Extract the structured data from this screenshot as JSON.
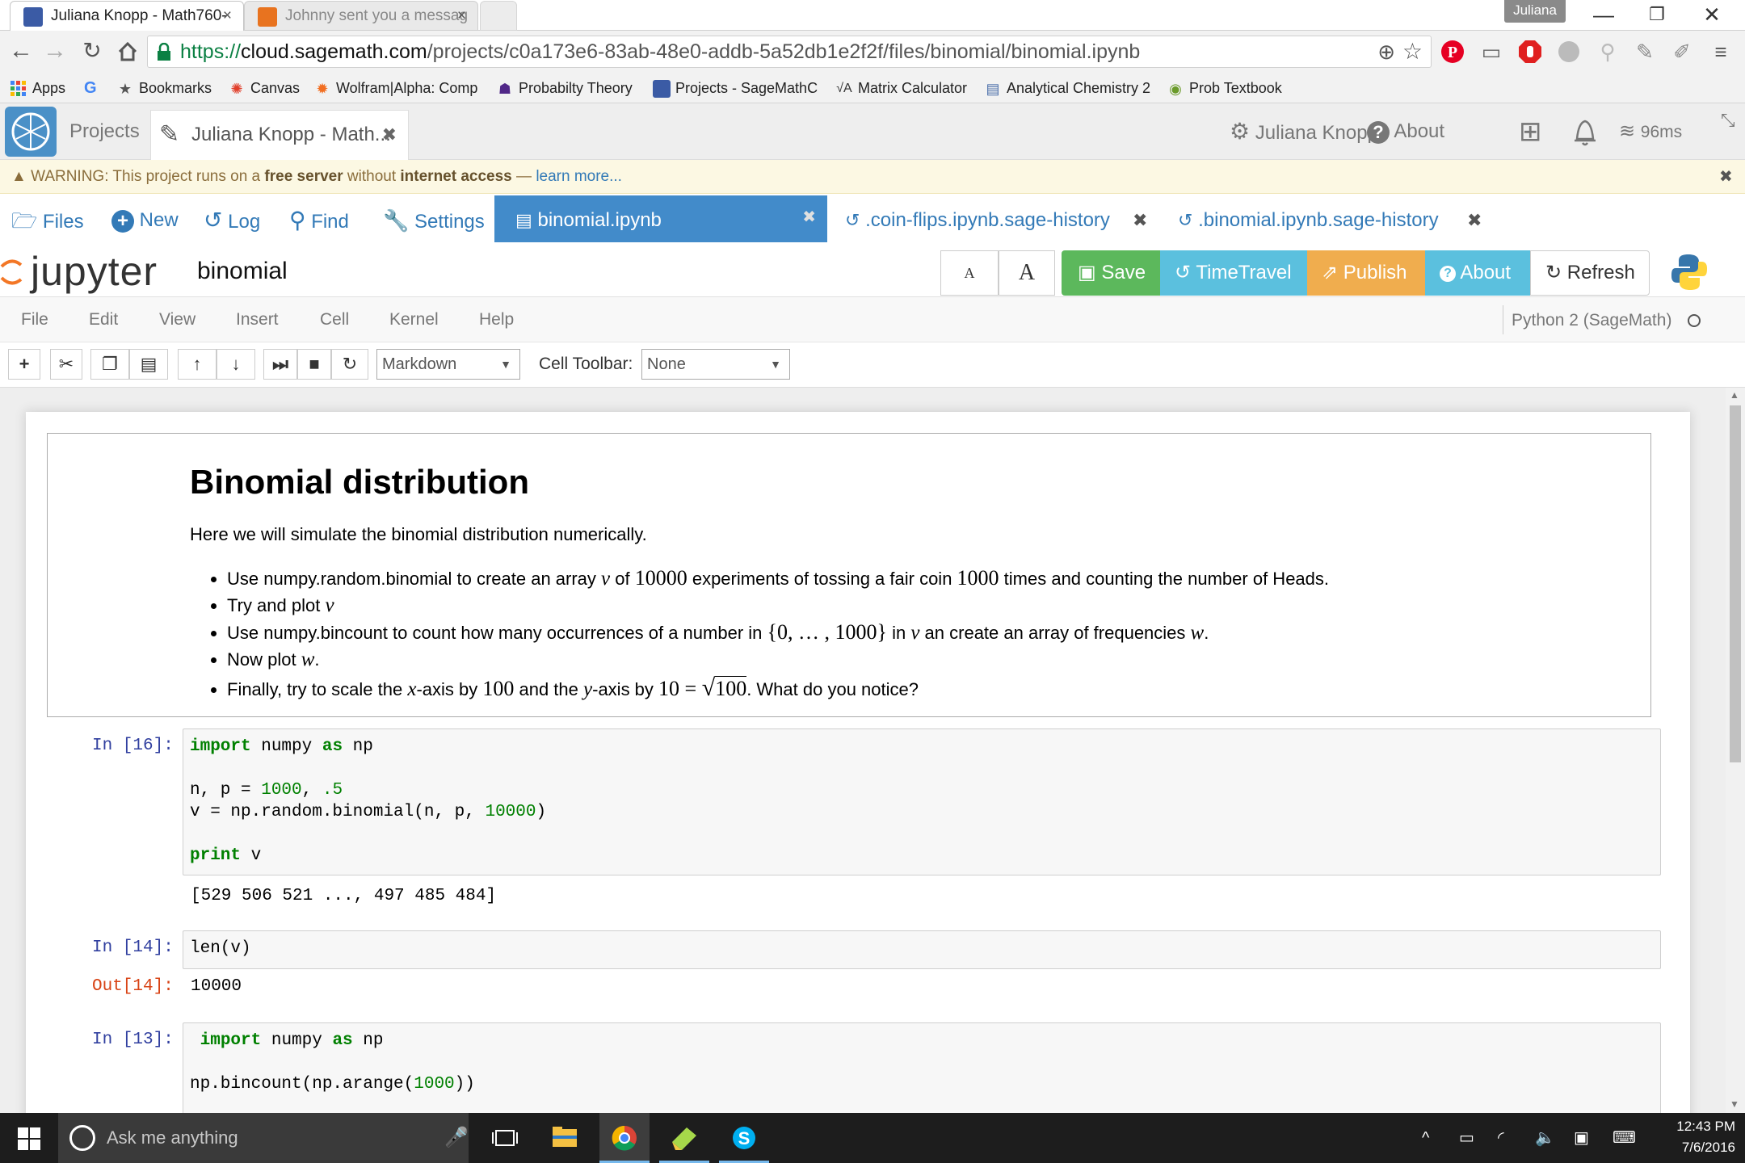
{
  "browser": {
    "tabs": [
      {
        "title": "Juliana Knopp - Math760-",
        "close": "×"
      },
      {
        "title": "Johnny sent you a messag",
        "close": "×"
      }
    ],
    "window_user": "Juliana",
    "window_controls": {
      "minimize": "—",
      "restore": "❐",
      "close": "✕"
    },
    "url_scheme": "https://",
    "url_host": "cloud.sagemath.com",
    "url_path": "/projects/c0a173e6-83ab-48e0-addb-5a52db1e2f2f/files/binomial/binomial.ipynb",
    "bookmarks": [
      {
        "label": "Apps",
        "icon": "apps-grid-icon"
      },
      {
        "label": "",
        "icon": "google-icon"
      },
      {
        "label": "Bookmarks",
        "icon": "star-icon"
      },
      {
        "label": "Canvas",
        "icon": "canvas-icon"
      },
      {
        "label": "Wolfram|Alpha: Comp",
        "icon": "wolfram-icon"
      },
      {
        "label": "Probabilty Theory",
        "icon": "k-state-icon"
      },
      {
        "label": "Projects - SageMathC",
        "icon": "sagemath-icon"
      },
      {
        "label": "Matrix Calculator",
        "icon": "matrix-icon"
      },
      {
        "label": "Analytical Chemistry 2",
        "icon": "doc-icon"
      },
      {
        "label": "Prob Textbook",
        "icon": "textbook-icon"
      }
    ]
  },
  "sage": {
    "projects": "Projects",
    "project_tab": "Juliana Knopp - Math...",
    "user": "Juliana Knopp",
    "about": "About",
    "ping": "96ms",
    "warning_prefix": "WARNING: This project runs on a ",
    "warning_bold1": "free server",
    "warning_mid": " without ",
    "warning_bold2": "internet access",
    "warning_dash": " — ",
    "warning_link": "learn more...",
    "nav": {
      "files": "Files",
      "new": "New",
      "log": "Log",
      "find": "Find",
      "settings": "Settings"
    },
    "file_tabs": [
      {
        "label": "binomial.ipynb",
        "active": true
      },
      {
        "label": ".coin-flips.ipynb.sage-history",
        "active": false
      },
      {
        "label": ".binomial.ipynb.sage-history",
        "active": false
      }
    ]
  },
  "jupyter": {
    "logo": "jupyter",
    "notebook_name": "binomial",
    "font_small": "A",
    "font_large": "A",
    "buttons": {
      "save": "Save",
      "timetravel": "TimeTravel",
      "publish": "Publish",
      "about": "About",
      "refresh": "Refresh"
    },
    "colors": {
      "save": "#5cb85c",
      "timetravel": "#5bc0de",
      "publish": "#f0ad4e",
      "about": "#5bc0de"
    },
    "menu": [
      "File",
      "Edit",
      "View",
      "Insert",
      "Cell",
      "Kernel",
      "Help"
    ],
    "kernel": "Python 2 (SageMath)",
    "cell_type": "Markdown",
    "cell_toolbar_label": "Cell Toolbar:",
    "cell_toolbar_value": "None"
  },
  "notebook": {
    "heading": "Binomial distribution",
    "intro": "Here we will simulate the binomial distribution numerically.",
    "bullets": {
      "b1_a": "Use numpy.random.binomial to create an array ",
      "b1_v": "v",
      "b1_b": " of ",
      "b1_n1": "10000",
      "b1_c": " experiments of tossing a fair coin ",
      "b1_n2": "1000",
      "b1_d": " times and counting the number of Heads.",
      "b2_a": "Try and plot ",
      "b2_v": "v",
      "b3_a": "Use numpy.bincount to count how many occurrences of a number in ",
      "b3_set": "{0, … , 1000}",
      "b3_b": " in ",
      "b3_v": "v",
      "b3_c": " an create an array of frequencies ",
      "b3_w": "w",
      "b3_d": ".",
      "b4_a": "Now plot ",
      "b4_w": "w",
      "b4_b": ".",
      "b5_a": "Finally, try to scale the ",
      "b5_x": "x",
      "b5_b": "-axis by ",
      "b5_n1": "100",
      "b5_c": " and the ",
      "b5_y": "y",
      "b5_d": "-axis by ",
      "b5_eq": "10 = ",
      "b5_sqrt": "100",
      "b5_e": ". What do you notice?"
    },
    "cells": [
      {
        "prompt": "In [16]:",
        "output": "[529 506 521 ..., 497 485 484]"
      },
      {
        "prompt": "In [14]:",
        "out_prompt": "Out[14]:",
        "output": "10000"
      },
      {
        "prompt": "In [13]:"
      }
    ],
    "code": {
      "c16_import": "import",
      "c16_numpy": " numpy ",
      "c16_as": "as",
      "c16_np": " np",
      "c16_l3a": "n, p = ",
      "c16_l3n": "1000",
      "c16_l3b": ", ",
      "c16_l3c": ".5",
      "c16_l4a": "v = np.random.binomial(n, p, ",
      "c16_l4n": "10000",
      "c16_l4b": ")",
      "c16_print": "print",
      "c16_v": " v",
      "c14": "len(v)",
      "c13_import": "import",
      "c13_numpy": " numpy ",
      "c13_as": "as",
      "c13_np": " np",
      "c13_l3a": "np.bincount(np.arange(",
      "c13_l3n": "1000",
      "c13_l3b": "))"
    }
  },
  "taskbar": {
    "search_placeholder": "Ask me anything",
    "time": "12:43 PM",
    "date": "7/6/2016"
  }
}
